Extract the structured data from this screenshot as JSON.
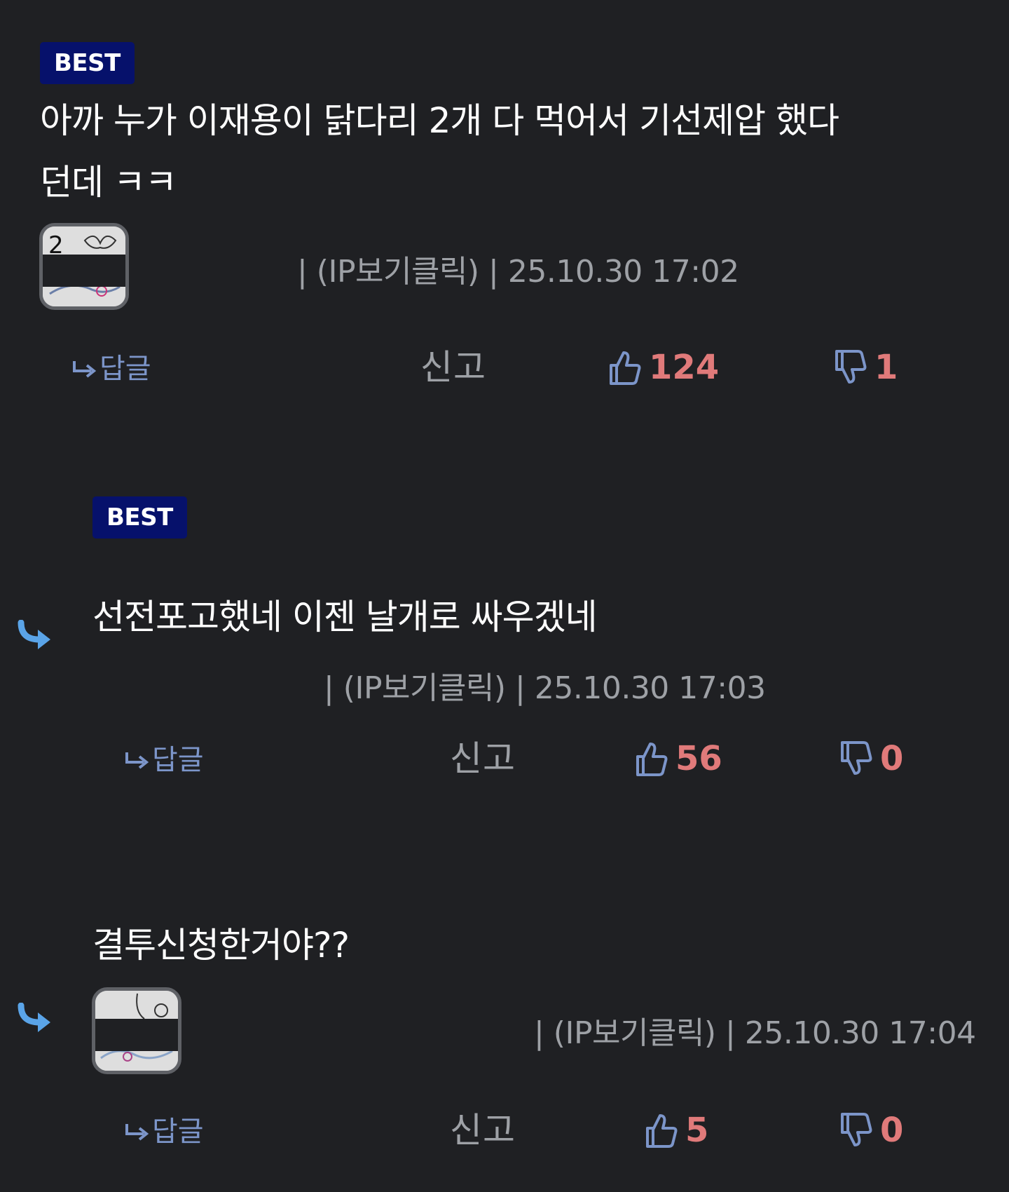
{
  "colors": {
    "background": "#1f2023",
    "best_badge": "#06116b",
    "count": "#e07a7a",
    "icon": "#7c95c9",
    "reply_arrow": "#5aa4e8",
    "meta": "#9ea1a6"
  },
  "comments": [
    {
      "badge": "BEST",
      "text_line1": "아까 누가 이재용이 닭다리 2개 다 먹어서 기선제압 했다",
      "text_line2": "던데 ㅋㅋ",
      "meta": "| (IP보기클릭) | 25.10.30 17:02",
      "reply_label": "답글",
      "report_label": "신고",
      "likes": "124",
      "dislikes": "1"
    },
    {
      "badge": "BEST",
      "text_line1": "선전포고했네 이젠 날개로 싸우겠네",
      "meta": "| (IP보기클릭) | 25.10.30 17:03",
      "reply_label": "답글",
      "report_label": "신고",
      "likes": "56",
      "dislikes": "0"
    },
    {
      "text_line1": "결투신청한거야??",
      "meta": "| (IP보기클릭) | 25.10.30 17:04",
      "reply_label": "답글",
      "report_label": "신고",
      "likes": "5",
      "dislikes": "0"
    }
  ]
}
